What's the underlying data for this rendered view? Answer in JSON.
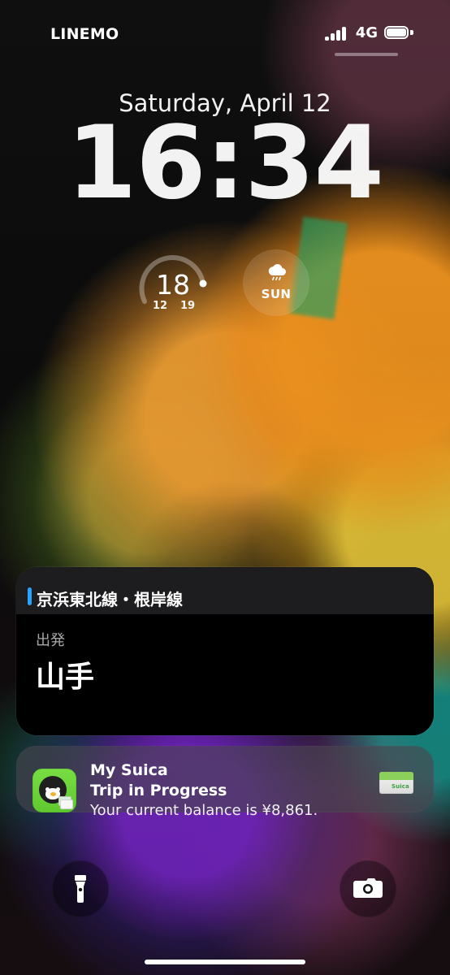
{
  "status_bar": {
    "carrier": "LINEMO",
    "network": "4G"
  },
  "lock_screen": {
    "date": "Saturday, April 12",
    "time": "16:34"
  },
  "widgets": {
    "temperature": {
      "current": "18",
      "low": "12",
      "high": "19"
    },
    "weather": {
      "day": "SUN",
      "icon": "rain-cloud-icon"
    }
  },
  "transit": {
    "line_name": "京浜東北線・根岸線",
    "departure_label": "出発",
    "station_name": "山手",
    "line_color": "#2aa3ff"
  },
  "notification": {
    "app_name": "My Suica",
    "title": "Trip in Progress",
    "message": "Your current balance is ¥8,861.",
    "card_label": "Suica"
  },
  "actions": {
    "flashlight_icon": "flashlight-icon",
    "camera_icon": "camera-icon"
  }
}
